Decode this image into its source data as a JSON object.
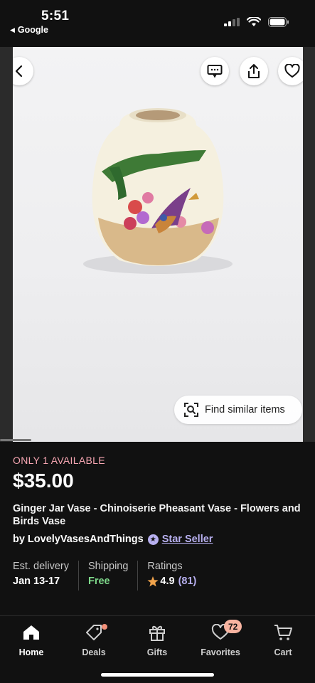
{
  "status": {
    "time": "5:51",
    "back_app": "Google"
  },
  "find_similar_label": "Find similar items",
  "product": {
    "availability": "ONLY 1 AVAILABLE",
    "price": "$35.00",
    "title": "Ginger Jar Vase - Chinoiserie Pheasant Vase - Flowers and Birds Vase",
    "seller_prefix": "by",
    "seller_name": "LovelyVasesAndThings",
    "star_seller": "Star Seller",
    "delivery_label": "Est. delivery",
    "delivery_value": "Jan 13-17",
    "shipping_label": "Shipping",
    "shipping_value": "Free",
    "ratings_label": "Ratings",
    "rating_value": "4.9",
    "rating_count": "(81)"
  },
  "tabs": [
    {
      "label": "Home",
      "icon": "home-icon",
      "active": true
    },
    {
      "label": "Deals",
      "icon": "tag-icon"
    },
    {
      "label": "Gifts",
      "icon": "gift-icon"
    },
    {
      "label": "Favorites",
      "icon": "heart-icon",
      "badge": "72"
    },
    {
      "label": "Cart",
      "icon": "cart-icon"
    }
  ],
  "colors": {
    "availability": "#f6a6b2",
    "star_seller": "#b8b0f0",
    "free_shipping": "#7ed88a",
    "rating_star": "#f1a34b",
    "favorites_badge": "#f7b3a0"
  }
}
